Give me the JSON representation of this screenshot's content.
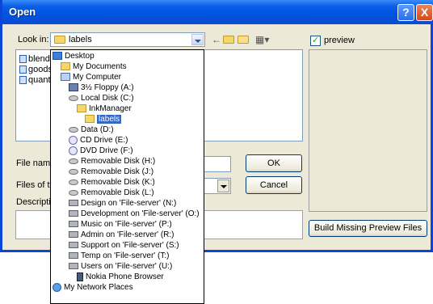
{
  "window": {
    "title": "Open"
  },
  "titlebar": {
    "help_glyph": "?",
    "close_glyph": "X"
  },
  "lookin": {
    "label": "Look in:",
    "value": "labels"
  },
  "toolbar": {
    "back_glyph": "←",
    "views_glyph": "▦▾"
  },
  "files": [
    {
      "name": "blend."
    },
    {
      "name": "goods"
    },
    {
      "name": "quant"
    }
  ],
  "filename": {
    "label": "File name",
    "value": ""
  },
  "filetype": {
    "label": "Files of typ",
    "value": ""
  },
  "description": {
    "label": "Descriptio"
  },
  "buttons": {
    "ok": "OK",
    "cancel": "Cancel",
    "build": "Build Missing Preview Files"
  },
  "preview": {
    "label": "preview",
    "checked": true,
    "check_glyph": "✓"
  },
  "dropdown_items": [
    {
      "label": "Desktop",
      "icon": "desktop-icon"
    },
    {
      "label": "My Documents",
      "icon": "folder-icon"
    },
    {
      "label": "My Computer",
      "icon": "computer-icon"
    },
    {
      "label": "3½ Floppy (A:)",
      "icon": "floppy-icon"
    },
    {
      "label": "Local Disk (C:)",
      "icon": "disk-icon"
    },
    {
      "label": "InkManager",
      "icon": "folder-icon"
    },
    {
      "label": "labels",
      "icon": "open-folder-icon",
      "selected": true
    },
    {
      "label": "Data (D:)",
      "icon": "disk-icon"
    },
    {
      "label": "CD Drive (E:)",
      "icon": "cd-icon"
    },
    {
      "label": "DVD Drive (F:)",
      "icon": "cd-icon"
    },
    {
      "label": "Removable Disk (H:)",
      "icon": "disk-icon"
    },
    {
      "label": "Removable Disk (J:)",
      "icon": "disk-icon"
    },
    {
      "label": "Removable Disk (K:)",
      "icon": "disk-icon"
    },
    {
      "label": "Removable Disk (L:)",
      "icon": "disk-icon"
    },
    {
      "label": "Design on 'File-server' (N:)",
      "icon": "network-drive-icon"
    },
    {
      "label": "Development on 'File-server' (O:)",
      "icon": "network-drive-icon"
    },
    {
      "label": "Music on 'File-server' (P:)",
      "icon": "network-drive-icon"
    },
    {
      "label": "Admin on 'File-server' (R:)",
      "icon": "network-drive-icon"
    },
    {
      "label": "Support on 'File-server' (S:)",
      "icon": "network-drive-icon"
    },
    {
      "label": "Temp on 'File-server' (T:)",
      "icon": "network-drive-icon"
    },
    {
      "label": "Users on 'File-server' (U:)",
      "icon": "network-drive-icon"
    },
    {
      "label": "Nokia Phone Browser",
      "icon": "phone-icon"
    },
    {
      "label": "My Network Places",
      "icon": "network-places-icon"
    }
  ]
}
